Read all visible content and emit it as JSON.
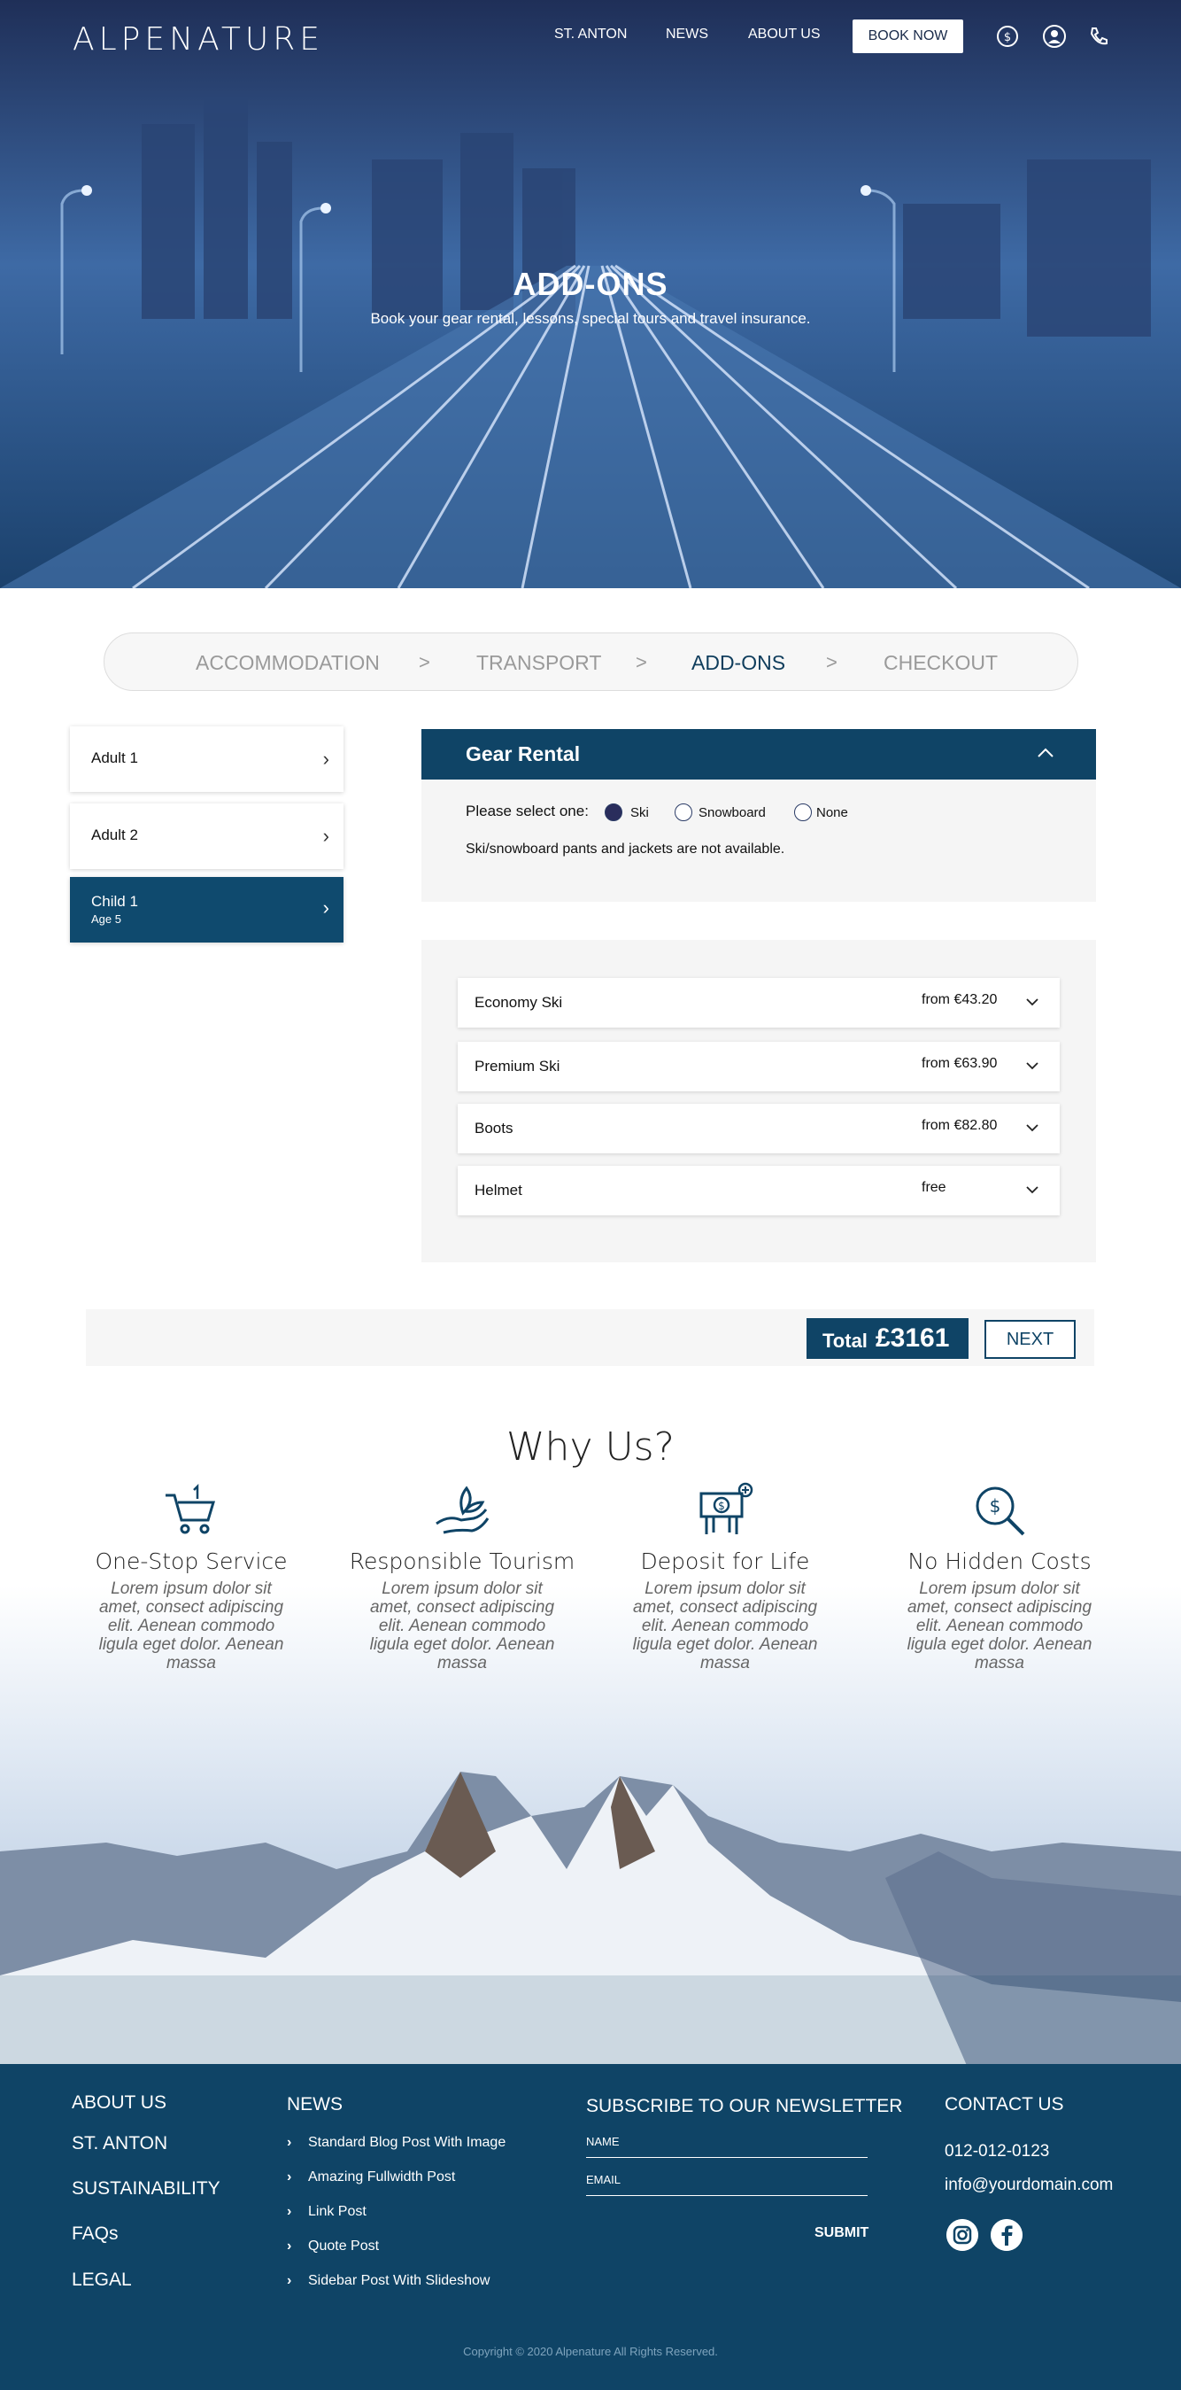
{
  "header": {
    "logo": "ALPENATURE",
    "nav": [
      "ST. ANTON",
      "NEWS",
      "ABOUT US"
    ],
    "book_now": "BOOK NOW"
  },
  "hero": {
    "title": "ADD-ONS",
    "subtitle": "Book your gear rental, lessons, special tours and travel insurance."
  },
  "steps": [
    "ACCOMMODATION",
    "TRANSPORT",
    "ADD-ONS",
    "CHECKOUT"
  ],
  "step_separator": ">",
  "active_step": "ADD-ONS",
  "travellers": [
    {
      "name": "Adult 1"
    },
    {
      "name": "Adult 2"
    },
    {
      "name": "Child 1",
      "age": "Age 5"
    }
  ],
  "gear": {
    "title": "Gear Rental",
    "select_label": "Please select one:",
    "options": [
      "Ski",
      "Snowboard",
      "None"
    ],
    "selected": "Ski",
    "note": "Ski/snowboard pants and jackets are not available.",
    "items": [
      {
        "name": "Economy Ski",
        "price": "from €43.20"
      },
      {
        "name": "Premium Ski",
        "price": "from €63.90"
      },
      {
        "name": "Boots",
        "price": "from €82.80"
      },
      {
        "name": "Helmet",
        "price": "free"
      }
    ]
  },
  "summary": {
    "total_label": "Total",
    "total_value": "£3161",
    "next": "NEXT"
  },
  "why": {
    "title": "Why Us?",
    "features": [
      {
        "title": "One-Stop Service",
        "icon": "cart-icon",
        "desc": "Lorem ipsum dolor sit amet, consect adipiscing elit. Aenean commodo ligula eget dolor. Aenean massa"
      },
      {
        "title": "Responsible Tourism",
        "icon": "hand-leaf-icon",
        "desc": "Lorem ipsum dolor sit amet, consect adipiscing elit. Aenean commodo ligula eget dolor. Aenean massa"
      },
      {
        "title": "Deposit for Life",
        "icon": "money-icon",
        "desc": "Lorem ipsum dolor sit amet, consect adipiscing elit. Aenean commodo ligula eget dolor. Aenean massa"
      },
      {
        "title": "No Hidden Costs",
        "icon": "search-dollar-icon",
        "desc": "Lorem ipsum dolor sit amet, consect adipiscing elit. Aenean commodo ligula eget dolor. Aenean massa"
      }
    ]
  },
  "footer": {
    "links": [
      "ABOUT US",
      "ST. ANTON",
      "SUSTAINABILITY",
      "FAQs",
      "LEGAL"
    ],
    "news_heading": "NEWS",
    "news": [
      "Standard Blog Post With Image",
      "Amazing Fullwidth Post",
      "Link Post",
      "Quote Post",
      "Sidebar Post With Slideshow"
    ],
    "newsletter_heading": "SUBSCRIBE TO OUR NEWSLETTER",
    "name_placeholder": "NAME",
    "email_placeholder": "EMAIL",
    "submit": "SUBMIT",
    "contact_heading": "CONTACT US",
    "phone": "012-012-0123",
    "email": "info@yourdomain.com",
    "copyright": "Copyright © 2020  Alpenature  All Rights Reserved."
  },
  "colors": {
    "primary": "#0f4466",
    "accent": "#0f4a6e",
    "hero": "#2c4f86"
  }
}
